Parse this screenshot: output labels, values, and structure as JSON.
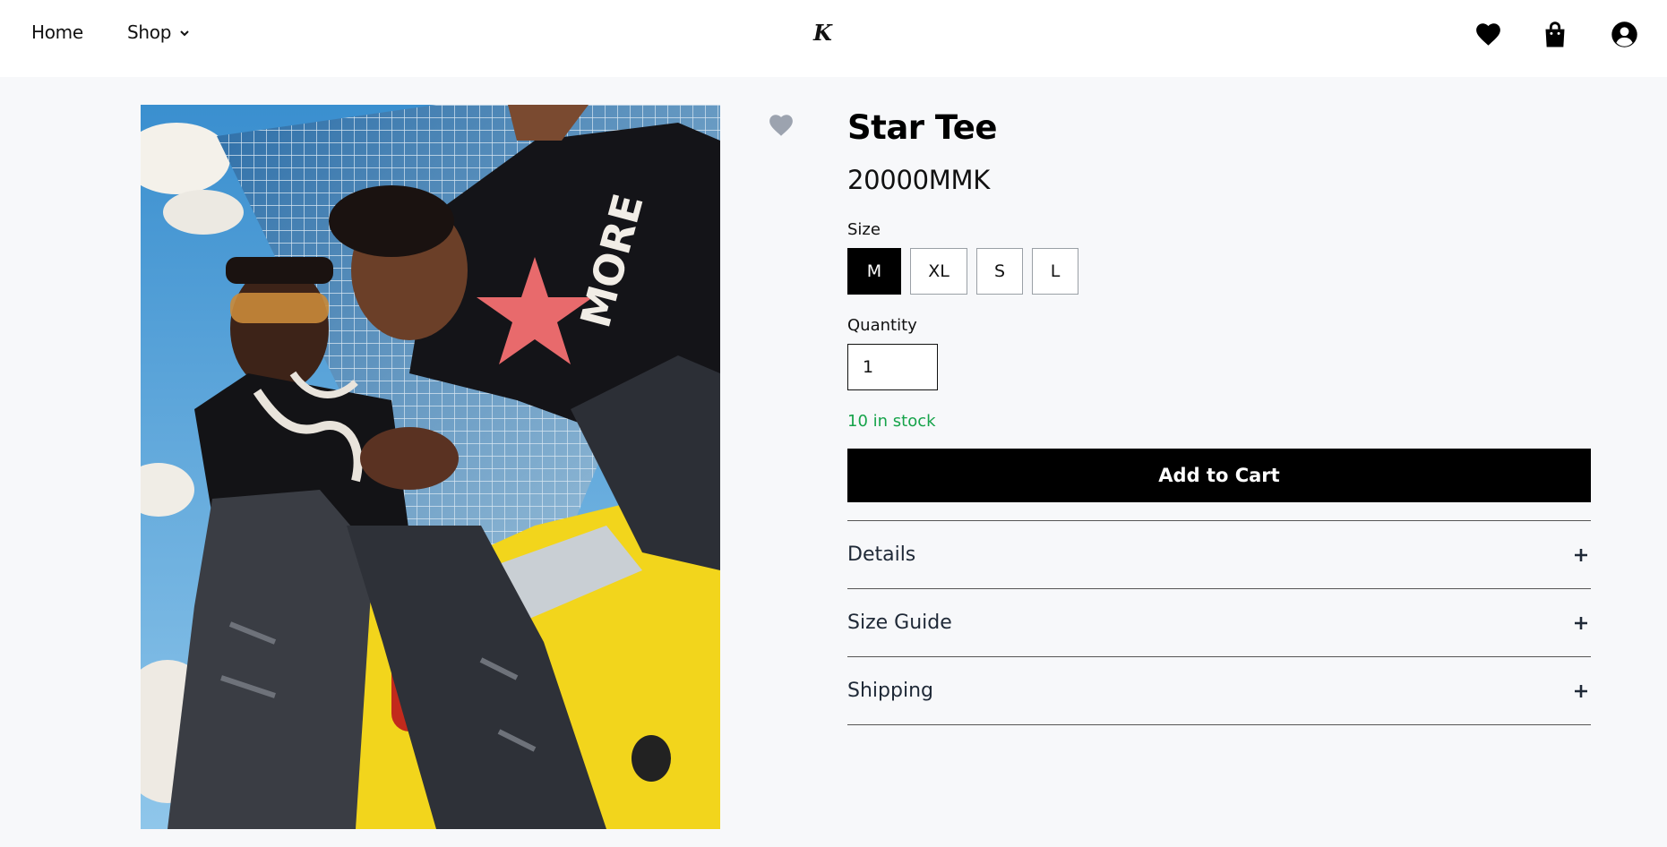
{
  "header": {
    "nav": {
      "home_label": "Home",
      "shop_label": "Shop"
    },
    "logo_text": "K",
    "icons": [
      "heart-icon",
      "shopping-bag-icon",
      "user-account-icon"
    ]
  },
  "product": {
    "title": "Star Tee",
    "price": "20000MMK",
    "size_label": "Size",
    "sizes": [
      "M",
      "XL",
      "S",
      "L"
    ],
    "selected_size": "M",
    "quantity_label": "Quantity",
    "quantity_value": "1",
    "stock_text": "10 in stock",
    "add_to_cart_label": "Add to Cart",
    "image_alt": "Two models in black graphic tees and distressed jeans posing by a yellow sports car"
  },
  "accordion": {
    "details": "Details",
    "size_guide": "Size Guide",
    "shipping": "Shipping"
  },
  "colors": {
    "accent": "#000000",
    "stock": "#16a34a",
    "background": "#f7f8fa",
    "wishlist_icon": "#9ca3af"
  }
}
